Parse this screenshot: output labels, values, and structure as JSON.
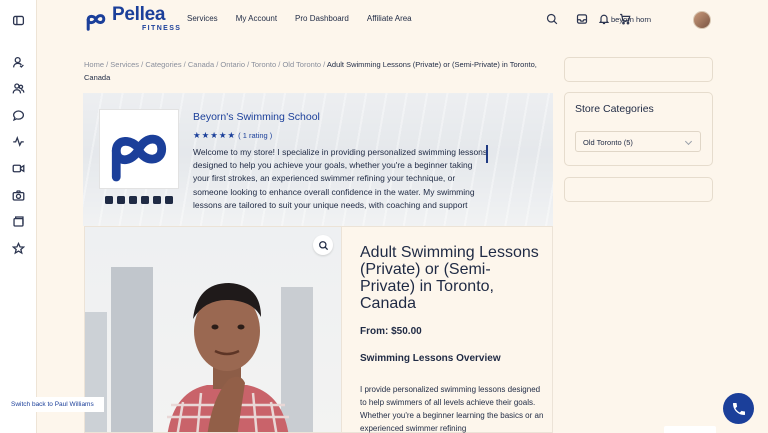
{
  "brand": {
    "name": "Pellea",
    "sub": "FITNESS",
    "color": "#1b3f9a"
  },
  "nav": [
    {
      "label": "Services"
    },
    {
      "label": "My Account"
    },
    {
      "label": "Pro Dashboard"
    },
    {
      "label": "Affiliate Area"
    }
  ],
  "header_icons": [
    "search-icon",
    "inbox-icon",
    "bell-icon",
    "cart-icon"
  ],
  "user": {
    "name": "beyorn horn"
  },
  "sidebar_icons": [
    "sidebar-toggle-icon",
    "user-check-icon",
    "users-icon",
    "chat-icon",
    "activity-icon",
    "video-icon",
    "camera-icon",
    "folder-icon",
    "star-icon"
  ],
  "breadcrumb": {
    "items": [
      "Home",
      "Services",
      "Categories",
      "Canada",
      "Ontario",
      "Toronto",
      "Old Toronto"
    ],
    "separator": " / ",
    "current": "Adult Swimming Lessons (Private) or (Semi-Private) in Toronto, Canada"
  },
  "store": {
    "name": "Beyorn's Swimming School",
    "stars": "★★★★★",
    "rating_text": "( 1 rating )",
    "description": "Welcome to my store! I specialize in providing personalized swimming lessons designed to help you achieve your goals, whether you're a beginner taking your first strokes, an experienced swimmer refining your technique, or someone looking to enhance overall confidence in the water. My swimming lessons are tailored to suit your unique needs, with coaching and support",
    "socials": [
      "twitter-icon",
      "instagram-icon",
      "facebook-icon",
      "linkedin-icon",
      "youtube-icon",
      "pinterest-icon"
    ]
  },
  "product": {
    "title": "Adult Swimming Lessons (Private) or (Semi-Private) in Toronto, Canada",
    "price": "From: $50.00",
    "overview_heading": "Swimming Lessons Overview",
    "description": "I provide personalized swimming lessons designed to help swimmers of all levels achieve their goals. Whether you're a beginner learning the basics or an experienced swimmer refining"
  },
  "sidebar_right": {
    "store_categories_title": "Store Categories",
    "category_selected": "Old Toronto  (5)"
  },
  "floating": {
    "switch_back": "Switch back to Paul Williams"
  }
}
